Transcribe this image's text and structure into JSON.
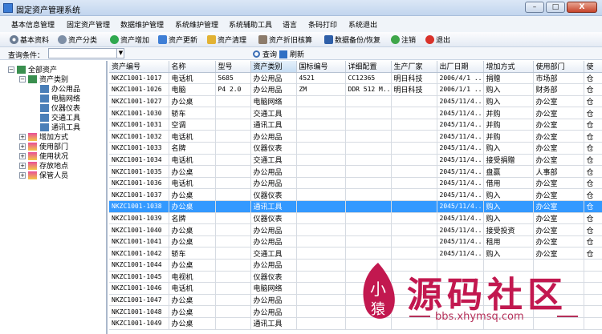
{
  "window": {
    "title": "固定资产管理系统",
    "min": "–",
    "max": "□",
    "close": "X"
  },
  "menu": [
    "基本信息管理",
    "固定资产管理",
    "数据维护管理",
    "系统维护管理",
    "系统辅助工具",
    "语言",
    "条码打印",
    "系统退出"
  ],
  "toolbar": {
    "basic": "基本资料",
    "category": "资产分类",
    "add": "资产增加",
    "update": "资产更新",
    "clean": "资产清理",
    "depreciation": "资产折旧核算",
    "backup": "数据备份/恢复",
    "logout": "注销",
    "exit": "退出"
  },
  "query": {
    "label": "查询条件：",
    "search": "查询",
    "refresh": "刷新"
  },
  "tree": {
    "root": "全部资产",
    "category": "资产类别",
    "children": [
      "办公用品",
      "电脑网络",
      "仪器仪表",
      "交通工具",
      "通讯工具"
    ],
    "others": [
      "增加方式",
      "使用部门",
      "使用状况",
      "存放地点",
      "保管人员"
    ]
  },
  "grid": {
    "columns": [
      "资产编号",
      "名称",
      "型号",
      "资产类别",
      "国标编号",
      "详细配置",
      "生产厂家",
      "出厂日期",
      "增加方式",
      "使用部门",
      "使"
    ],
    "rows": [
      [
        "NKZC1001-1017",
        "电话机",
        "5685",
        "办公用品",
        "4521",
        "CC12365",
        "明日科技",
        "2006/4/1 ...",
        "捐赠",
        "市场部",
        "仓"
      ],
      [
        "NKZC1001-1026",
        "电脑",
        "P4 2.0",
        "办公用品",
        "ZM",
        "DDR 512 M...",
        "明日科技",
        "2006/1/1 ...",
        "购入",
        "财务部",
        "仓"
      ],
      [
        "NKZC1001-1027",
        "办公桌",
        "",
        "电脑网络",
        "",
        "",
        "",
        "2045/11/4...",
        "购入",
        "办公室",
        "仓"
      ],
      [
        "NKZC1001-1030",
        "轿车",
        "",
        "交通工具",
        "",
        "",
        "",
        "2045/11/4...",
        "并购",
        "办公室",
        "仓"
      ],
      [
        "NKZC1001-1031",
        "空调",
        "",
        "通讯工具",
        "",
        "",
        "",
        "2045/11/4...",
        "并购",
        "办公室",
        "仓"
      ],
      [
        "NKZC1001-1032",
        "电话机",
        "",
        "办公用品",
        "",
        "",
        "",
        "2045/11/4...",
        "并购",
        "办公室",
        "仓"
      ],
      [
        "NKZC1001-1033",
        "名牌",
        "",
        "仪器仪表",
        "",
        "",
        "",
        "2045/11/4...",
        "购入",
        "办公室",
        "仓"
      ],
      [
        "NKZC1001-1034",
        "电话机",
        "",
        "交通工具",
        "",
        "",
        "",
        "2045/11/4...",
        "接受捐赠",
        "办公室",
        "仓"
      ],
      [
        "NKZC1001-1035",
        "办公桌",
        "",
        "办公用品",
        "",
        "",
        "",
        "2045/11/4...",
        "盘赢",
        "人事部",
        "仓"
      ],
      [
        "NKZC1001-1036",
        "电话机",
        "",
        "办公用品",
        "",
        "",
        "",
        "2045/11/4...",
        "借用",
        "办公室",
        "仓"
      ],
      [
        "NKZC1001-1037",
        "办公桌",
        "",
        "仪器仪表",
        "",
        "",
        "",
        "2045/11/4...",
        "购入",
        "办公室",
        "仓"
      ],
      [
        "NKZC1001-1038",
        "办公桌",
        "",
        "通讯工具",
        "",
        "",
        "",
        "2045/11/4...",
        "购入",
        "办公室",
        "仓"
      ],
      [
        "NKZC1001-1039",
        "名牌",
        "",
        "仪器仪表",
        "",
        "",
        "",
        "2045/11/4...",
        "购入",
        "办公室",
        "仓"
      ],
      [
        "NKZC1001-1040",
        "办公桌",
        "",
        "办公用品",
        "",
        "",
        "",
        "2045/11/4...",
        "接受投资",
        "办公室",
        "仓"
      ],
      [
        "NKZC1001-1041",
        "办公桌",
        "",
        "办公用品",
        "",
        "",
        "",
        "2045/11/4...",
        "租用",
        "办公室",
        "仓"
      ],
      [
        "NKZC1001-1042",
        "轿车",
        "",
        "交通工具",
        "",
        "",
        "",
        "2045/11/4...",
        "购入",
        "办公室",
        "仓"
      ],
      [
        "NKZC1001-1044",
        "办公桌",
        "",
        "办公用品",
        "",
        "",
        "",
        "",
        "",
        "",
        ""
      ],
      [
        "NKZC1001-1045",
        "电视机",
        "",
        "仪器仪表",
        "",
        "",
        "",
        "",
        "",
        "",
        ""
      ],
      [
        "NKZC1001-1046",
        "电话机",
        "",
        "电脑网络",
        "",
        "",
        "",
        "",
        "",
        "",
        ""
      ],
      [
        "NKZC1001-1047",
        "办公桌",
        "",
        "办公用品",
        "",
        "",
        "",
        "",
        "",
        "",
        ""
      ],
      [
        "NKZC1001-1048",
        "办公桌",
        "",
        "办公用品",
        "",
        "",
        "",
        "",
        "",
        "",
        ""
      ],
      [
        "NKZC1001-1049",
        "办公桌",
        "",
        "通讯工具",
        "",
        "",
        "",
        "",
        "",
        "",
        ""
      ]
    ],
    "selected_row": 11
  },
  "watermark": {
    "brand": "源码社区",
    "url": "bbs.xhymsq.com",
    "seal": "小猿"
  }
}
